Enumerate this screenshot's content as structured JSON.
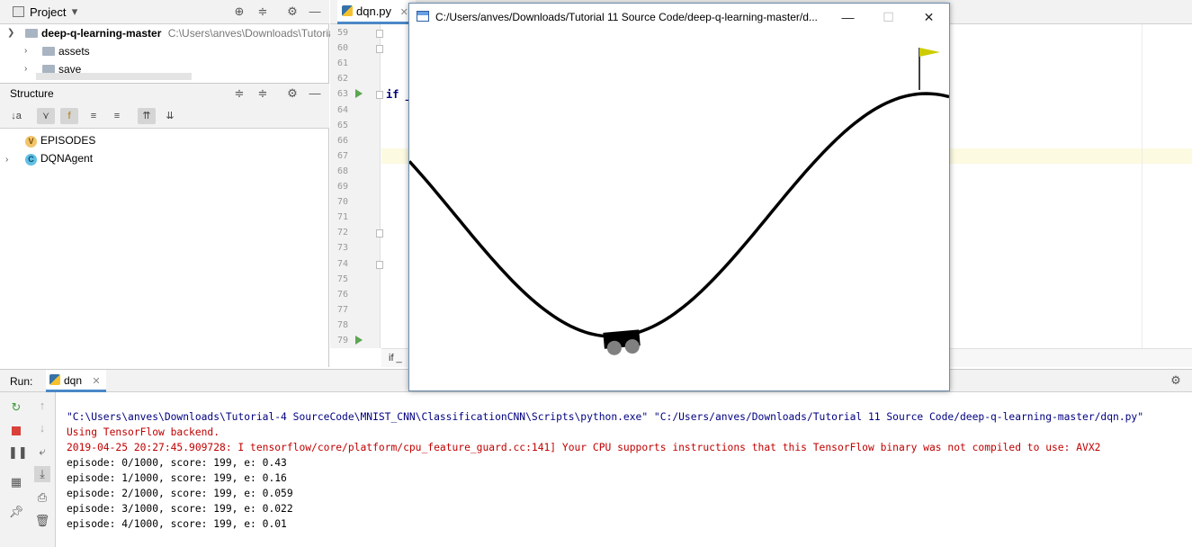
{
  "project_panel": {
    "title": "Project",
    "root": {
      "name": "deep-q-learning-master",
      "path": "C:\\Users\\anves\\Downloads\\Tutorial"
    },
    "children": [
      "assets",
      "save"
    ]
  },
  "structure_panel": {
    "title": "Structure",
    "items": [
      {
        "badge": "V",
        "name": "EPISODES"
      },
      {
        "badge": "C",
        "name": "DQNAgent"
      }
    ]
  },
  "editor": {
    "tab_label": "dqn.py",
    "line_numbers": [
      "59",
      "60",
      "61",
      "62",
      "63",
      "64",
      "65",
      "66",
      "67",
      "68",
      "69",
      "70",
      "71",
      "72",
      "73",
      "74",
      "75",
      "76",
      "77",
      "78",
      "79"
    ],
    "code_visible": "if _",
    "breadcrumb": "if _"
  },
  "run_panel": {
    "label": "Run:",
    "tab_label": "dqn",
    "console": {
      "command": "\"C:\\Users\\anves\\Downloads\\Tutorial-4 SourceCode\\MNIST_CNN\\ClassificationCNN\\Scripts\\python.exe\" \"C:/Users/anves/Downloads/Tutorial 11 Source Code/deep-q-learning-master/dqn.py\"",
      "stderr": [
        "Using TensorFlow backend.",
        "2019-04-25 20:27:45.909728: I tensorflow/core/platform/cpu_feature_guard.cc:141] Your CPU supports instructions that this TensorFlow binary was not compiled to use: AVX2"
      ],
      "stdout": [
        "episode: 0/1000, score: 199, e: 0.43",
        "episode: 1/1000, score: 199, e: 0.16",
        "episode: 2/1000, score: 199, e: 0.059",
        "episode: 3/1000, score: 199, e: 0.022",
        "episode: 4/1000, score: 199, e: 0.01"
      ]
    }
  },
  "gym_window": {
    "title": "C:/Users/anves/Downloads/Tutorial 11 Source Code/deep-q-learning-master/d...",
    "minimize": "—",
    "maximize": "☐",
    "close": "✕",
    "flag_color": "#cccc00"
  },
  "colors": {
    "accent": "#4a88c7",
    "error_text": "#c00000",
    "command_text": "#000080",
    "run_green": "#5ba651"
  }
}
